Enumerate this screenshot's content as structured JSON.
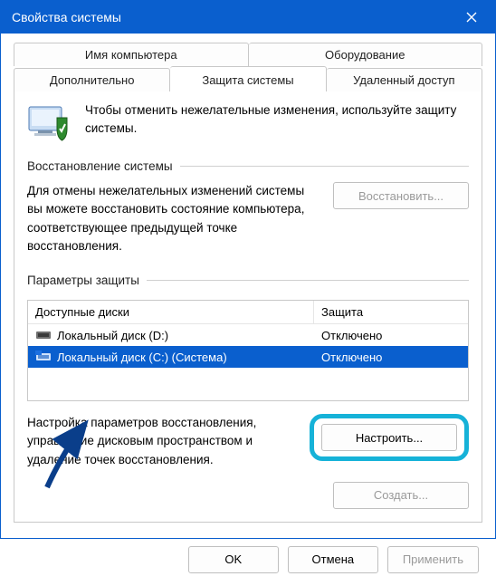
{
  "window": {
    "title": "Свойства системы"
  },
  "tabs": {
    "row1": [
      "Имя компьютера",
      "Оборудование"
    ],
    "row2": [
      "Дополнительно",
      "Защита системы",
      "Удаленный доступ"
    ],
    "active": "Защита системы"
  },
  "intro": "Чтобы отменить нежелательные изменения, используйте защиту системы.",
  "sections": {
    "restore": {
      "label": "Восстановление системы",
      "text": "Для отмены нежелательных изменений системы вы можете восстановить состояние компьютера, соответствующее предыдущей точке восстановления.",
      "button": "Восстановить..."
    },
    "protection": {
      "label": "Параметры защиты",
      "columns": {
        "drive": "Доступные диски",
        "status": "Защита"
      },
      "drives": [
        {
          "name": "Локальный диск (D:)",
          "status": "Отключено",
          "selected": false,
          "system": false
        },
        {
          "name": "Локальный диск (C:) (Система)",
          "status": "Отключено",
          "selected": true,
          "system": true
        }
      ],
      "config_text": "Настройка параметров восстановления, управление дисковым пространством и удаление точек восстановления.",
      "config_button": "Настроить...",
      "create_button": "Создать..."
    }
  },
  "footer": {
    "ok": "OK",
    "cancel": "Отмена",
    "apply": "Применить"
  },
  "colors": {
    "accent": "#0a5fce",
    "highlight": "#16b2d8"
  }
}
